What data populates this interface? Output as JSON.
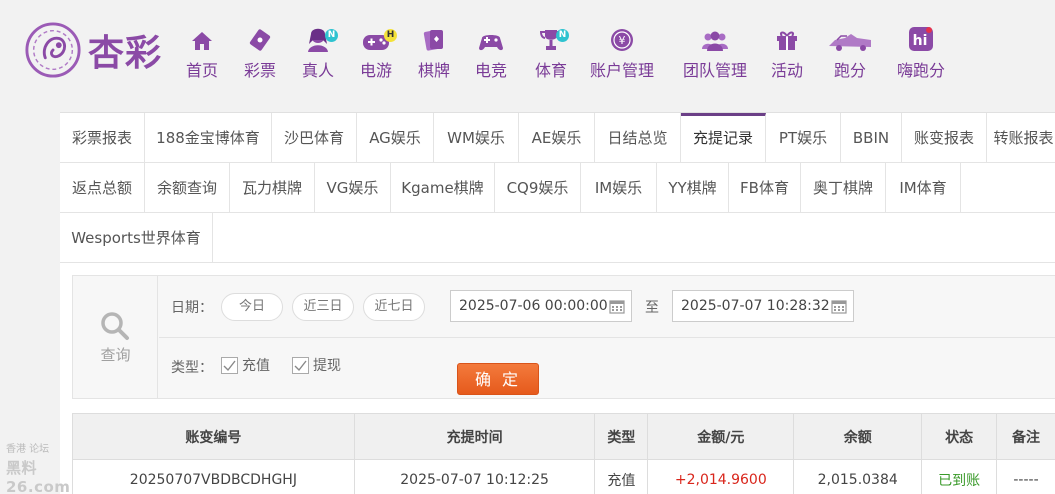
{
  "brand": {
    "name": "杏彩",
    "color": "#8b4aa6"
  },
  "nav": [
    {
      "label": "首页",
      "icon": "home-icon"
    },
    {
      "label": "彩票",
      "icon": "lottery-ticket-icon"
    },
    {
      "label": "真人",
      "icon": "live-dealer-icon",
      "badge": "N"
    },
    {
      "label": "电游",
      "icon": "gamepad-icon",
      "badge": "H"
    },
    {
      "label": "棋牌",
      "icon": "cards-icon"
    },
    {
      "label": "电竞",
      "icon": "esports-controller-icon"
    },
    {
      "label": "体育",
      "icon": "trophy-icon",
      "badge": "N"
    },
    {
      "label": "账户管理",
      "icon": "account-coin-icon"
    },
    {
      "label": "团队管理",
      "icon": "team-users-icon"
    },
    {
      "label": "活动",
      "icon": "gift-icon"
    },
    {
      "label": "跑分",
      "icon": "race-car-icon"
    },
    {
      "label": "嗨跑分",
      "icon": "hi-app-icon"
    }
  ],
  "tabs": {
    "row1": [
      "彩票报表",
      "188金宝博体育",
      "沙巴体育",
      "AG娱乐",
      "WM娱乐",
      "AE娱乐",
      "日结总览",
      "充提记录",
      "PT娱乐",
      "BBIN",
      "账变报表",
      "转账报表"
    ],
    "row2": [
      "返点总额",
      "余额查询",
      "瓦力棋牌",
      "VG娱乐",
      "Kgame棋牌",
      "CQ9娱乐",
      "IM娱乐",
      "YY棋牌",
      "FB体育",
      "奥丁棋牌",
      "IM体育"
    ],
    "row3": [
      "Wesports世界体育"
    ],
    "active": "充提记录"
  },
  "filter": {
    "query_label": "查询",
    "date_label": "日期：",
    "quick": [
      "今日",
      "近三日",
      "近七日"
    ],
    "date_from": "2025-07-06 00:00:00",
    "to_label": "至",
    "date_to": "2025-07-07 10:28:32",
    "type_label": "类型：",
    "types": [
      {
        "label": "充值",
        "checked": true
      },
      {
        "label": "提现",
        "checked": true
      }
    ],
    "confirm": "确 定"
  },
  "table": {
    "headers": [
      "账变编号",
      "充提时间",
      "类型",
      "金额/元",
      "余额",
      "状态",
      "备注"
    ],
    "rows": [
      {
        "id": "20250707VBDBCDHGHJ",
        "time": "2025-07-07 10:12:25",
        "type": "充值",
        "amount": "+2,014.9600",
        "balance": "2,015.0384",
        "status": "已到账",
        "note": "-----"
      }
    ],
    "amount_color": "#d9261c",
    "status_color": "#3a9a2a"
  },
  "watermark": {
    "line1": "香港   论坛",
    "line2": "黑料26.com"
  }
}
